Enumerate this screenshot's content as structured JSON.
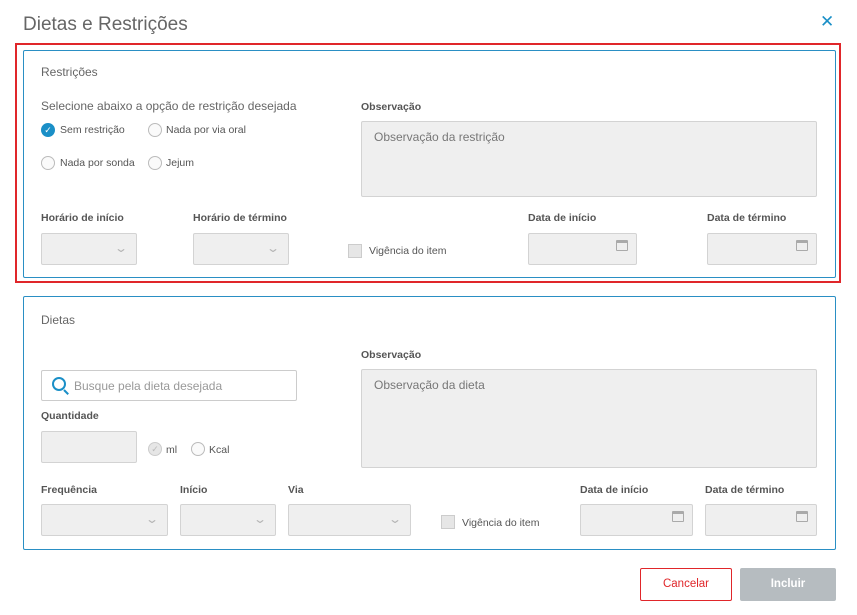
{
  "dialog": {
    "title": "Dietas e Restrições",
    "close_icon": "close-icon"
  },
  "restricoes": {
    "title": "Restrições",
    "prompt": "Selecione abaixo a opção de restrição desejada",
    "options": [
      {
        "label": "Sem restrição",
        "checked": true
      },
      {
        "label": "Nada por via oral",
        "checked": false
      },
      {
        "label": "Nada por sonda",
        "checked": false
      },
      {
        "label": "Jejum",
        "checked": false
      }
    ],
    "observacao_label": "Observação",
    "observacao_placeholder": "Observação da restrição",
    "horario_inicio_label": "Horário de início",
    "horario_termino_label": "Horário de término",
    "vigencia_label": "Vigência do item",
    "data_inicio_label": "Data de início",
    "data_termino_label": "Data de término"
  },
  "dietas": {
    "title": "Dietas",
    "search_placeholder": "Busque pela dieta desejada",
    "quantidade_label": "Quantidade",
    "unit_ml": "ml",
    "unit_kcal": "Kcal",
    "observacao_label": "Observação",
    "observacao_placeholder": "Observação da dieta",
    "frequencia_label": "Frequência",
    "inicio_label": "Início",
    "via_label": "Via",
    "vigencia_label": "Vigência do item",
    "data_inicio_label": "Data de início",
    "data_termino_label": "Data de término"
  },
  "footer": {
    "cancel_label": "Cancelar",
    "submit_label": "Incluir"
  },
  "colors": {
    "accent": "#1a8fc7",
    "highlight": "#e0262a",
    "disabled_button": "#b6bcc0"
  }
}
